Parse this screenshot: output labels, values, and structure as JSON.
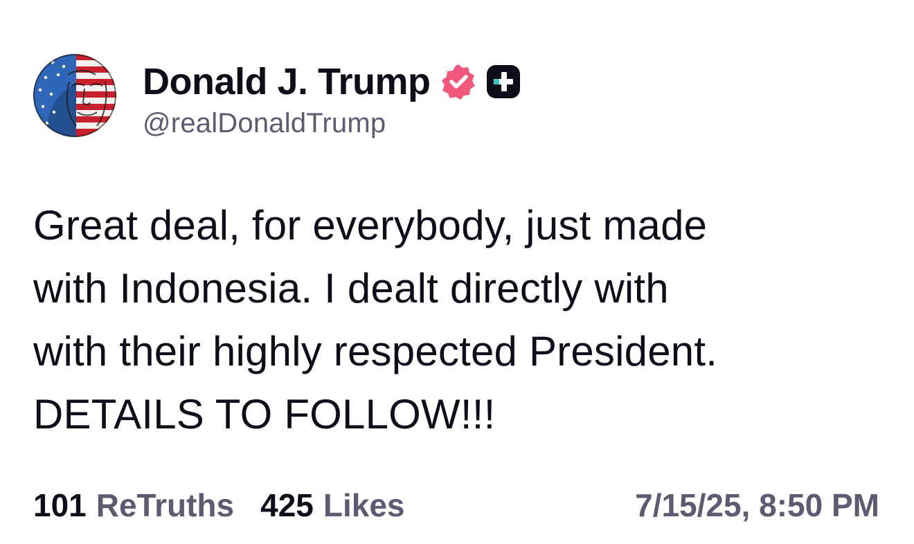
{
  "author": {
    "display_name": "Donald J. Trump",
    "handle": "@realDonaldTrump",
    "avatar_icon": "american-flag-portrait-avatar",
    "verified_icon": "verified-check-badge-icon",
    "plus_icon": "truth-plus-badge-icon"
  },
  "post": {
    "text": "Great deal, for everybody, just made\nwith Indonesia. I dealt directly with\nwith their highly respected President.\nDETAILS TO FOLLOW!!!"
  },
  "stats": {
    "retruths_count": "101",
    "retruths_label": "ReTruths",
    "likes_count": "425",
    "likes_label": "Likes"
  },
  "timestamp": "7/15/25, 8:50 PM",
  "colors": {
    "text_primary": "#0f0d1a",
    "text_secondary": "#5d5a72",
    "verified_badge": "#f0577a",
    "plus_badge": "#0f0d1a"
  }
}
